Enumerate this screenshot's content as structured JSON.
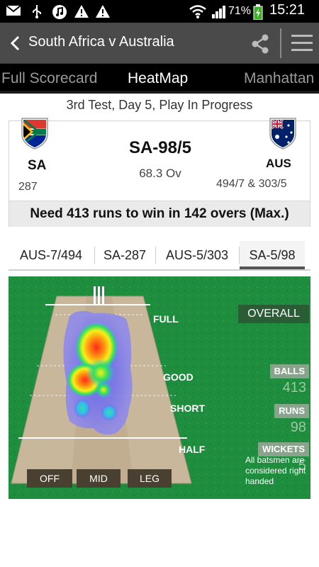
{
  "status_bar": {
    "battery": "71%",
    "time": "15:21"
  },
  "app_bar": {
    "title": "South Africa v Australia"
  },
  "tabs": [
    {
      "label": "Full Scorecard",
      "active": false
    },
    {
      "label": "HeatMap",
      "active": true
    },
    {
      "label": "Manhattan",
      "active": false
    }
  ],
  "match": {
    "status": "3rd Test, Day 5, Play In Progress",
    "batting_score": "SA-98/5",
    "overs": "68.3 Ov",
    "need": "Need 413 runs to win in 142 overs (Max.)",
    "home": {
      "code": "SA",
      "score": "287"
    },
    "away": {
      "code": "AUS",
      "score": "494/7 & 303/5"
    }
  },
  "innings_tabs": [
    {
      "label": "AUS-7/494",
      "active": false
    },
    {
      "label": "SA-287",
      "active": false
    },
    {
      "label": "AUS-5/303",
      "active": false
    },
    {
      "label": "SA-5/98",
      "active": true
    }
  ],
  "heatmap": {
    "zones": [
      "FULL",
      "GOOD",
      "SHORT",
      "HALF"
    ],
    "directions": [
      "OFF",
      "MID",
      "LEG"
    ],
    "overall": {
      "title": "OVERALL",
      "stats": [
        {
          "label": "BALLS",
          "value": "413"
        },
        {
          "label": "RUNS",
          "value": "98"
        },
        {
          "label": "WICKETS",
          "value": "5"
        }
      ]
    },
    "note": "All batsmen are considered right handed"
  },
  "colors": {
    "action_bar": "#4a4a4a",
    "field_green": "#1e8a3c",
    "pitch": "#c8b79a"
  }
}
